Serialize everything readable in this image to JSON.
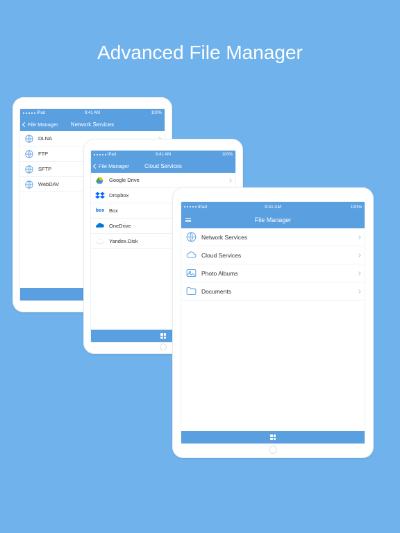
{
  "title": "Advanced File Manager",
  "status": {
    "carrier": "iPad",
    "time": "9:41 AM"
  },
  "back_label": "File Manager",
  "screens": {
    "network": {
      "title": "Network Services",
      "items": [
        "DLNA",
        "FTP",
        "SFTP",
        "WebDAV"
      ]
    },
    "cloud": {
      "title": "Cloud Services",
      "items": [
        "Google Drive",
        "Dropbox",
        "Box",
        "OneDrive",
        "Yandex.Disk"
      ]
    },
    "main": {
      "title": "File Manager",
      "items": [
        "Network Services",
        "Cloud Services",
        "Photo Albums",
        "Documents"
      ]
    }
  },
  "cloud_icons": [
    "gdrive",
    "dropbox",
    "box",
    "onedrive",
    "yandex"
  ],
  "main_icons": [
    "globe",
    "cloud",
    "photo",
    "folder"
  ]
}
